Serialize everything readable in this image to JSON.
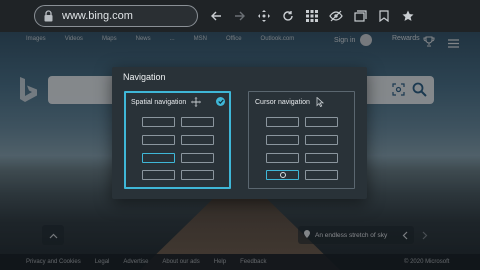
{
  "browser": {
    "url": "www.bing.com",
    "toolbar_icons": [
      "back-icon",
      "forward-icon",
      "directional-pad-icon",
      "refresh-icon",
      "apps-grid-icon",
      "hide-eye-icon",
      "tab-view-icon",
      "bookmark-icon",
      "favorite-star-icon"
    ]
  },
  "page": {
    "top_nav": [
      "Images",
      "Videos",
      "Maps",
      "News",
      "...",
      "MSN",
      "Office",
      "Outlook.com"
    ],
    "signin": "Sign in",
    "rewards": "Rewards",
    "caption": "An endless stretch of sky",
    "footer_links": [
      "Privacy and Cookies",
      "Legal",
      "Advertise",
      "About our ads",
      "Help",
      "Feedback"
    ],
    "copyright": "© 2020 Microsoft"
  },
  "dialog": {
    "title": "Navigation",
    "spatial": {
      "label": "Spatial navigation",
      "selected": true
    },
    "cursor": {
      "label": "Cursor navigation",
      "selected": false
    }
  },
  "colors": {
    "accent": "#3fb7d7",
    "dialog_bg": "#293238",
    "chrome_bg": "#1f2326"
  }
}
